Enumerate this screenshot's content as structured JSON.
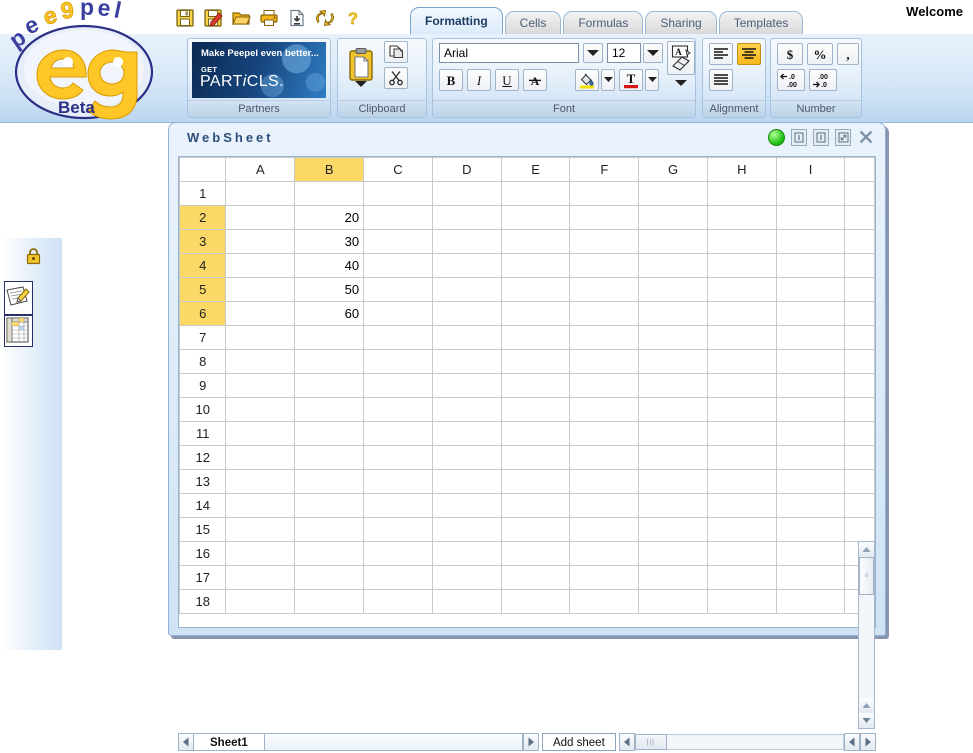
{
  "app": {
    "brand": "peepel",
    "brand_badge": "Beta",
    "welcome": "Welcome"
  },
  "quick_toolbar": [
    {
      "name": "save-icon",
      "title": "Save"
    },
    {
      "name": "save-as-icon",
      "title": "Save as"
    },
    {
      "name": "open-folder-icon",
      "title": "Open"
    },
    {
      "name": "print-icon",
      "title": "Print"
    },
    {
      "name": "import-icon",
      "title": "Import"
    },
    {
      "name": "refresh-icon",
      "title": "Refresh"
    },
    {
      "name": "help-icon",
      "title": "Help"
    }
  ],
  "tabs": [
    {
      "label": "Formatting",
      "active": true
    },
    {
      "label": "Cells",
      "active": false
    },
    {
      "label": "Formulas",
      "active": false
    },
    {
      "label": "Sharing",
      "active": false
    },
    {
      "label": "Templates",
      "active": false
    }
  ],
  "ribbon": {
    "partners": {
      "label": "Partners",
      "ad_line1": "Make Peepel even better...",
      "ad_get": "GET",
      "ad_brand_pre": "PART",
      "ad_brand_i": "i",
      "ad_brand_post": "CLS."
    },
    "clipboard": {
      "label": "Clipboard",
      "paste": "Paste",
      "copy": "Copy",
      "cut": "Cut"
    },
    "font": {
      "label": "Font",
      "font_name": "Arial",
      "font_size": "12",
      "bold": "B",
      "italic": "I",
      "underline": "U",
      "strikethrough": "A",
      "fill_color": "#f2e000",
      "text_color": "#d71414",
      "clear_formatting": "Clear formatting"
    },
    "alignment": {
      "label": "Alignment",
      "align_left": "Align left",
      "align_center": "Align center",
      "align_justify": "Justify",
      "active": "align_center"
    },
    "number": {
      "label": "Number",
      "currency": "$",
      "percent": "%",
      "comma": ",",
      "decrease_decimal": "Decrease decimal",
      "increase_decimal": "Increase decimal"
    }
  },
  "sidebar": {
    "items": [
      {
        "name": "lock-icon",
        "label": "Locked"
      },
      {
        "name": "writer-app-icon",
        "label": "Writer"
      },
      {
        "name": "sheet-app-icon",
        "label": "Sheet"
      }
    ]
  },
  "window": {
    "title": "WebSheet",
    "status": "online",
    "status_color": "#23c416",
    "controls": [
      "minimize",
      "restore",
      "maximize",
      "close"
    ]
  },
  "sheet": {
    "columns": [
      "A",
      "B",
      "C",
      "D",
      "E",
      "F",
      "G",
      "H",
      "I"
    ],
    "rows": [
      1,
      2,
      3,
      4,
      5,
      6,
      7,
      8,
      9,
      10,
      11,
      12,
      13,
      14,
      15,
      16,
      17,
      18
    ],
    "selected_column": "B",
    "selected_rows": [
      2,
      3,
      4,
      5,
      6
    ],
    "active_cell": "B6",
    "cells": {
      "B2": "20",
      "B3": "30",
      "B4": "40",
      "B5": "50",
      "B6": "60"
    }
  },
  "sheetbar": {
    "prev_sheet": "Previous sheet",
    "next_sheet": "Next sheet",
    "sheet_tab": "Sheet1",
    "add_sheet": "Add sheet"
  }
}
